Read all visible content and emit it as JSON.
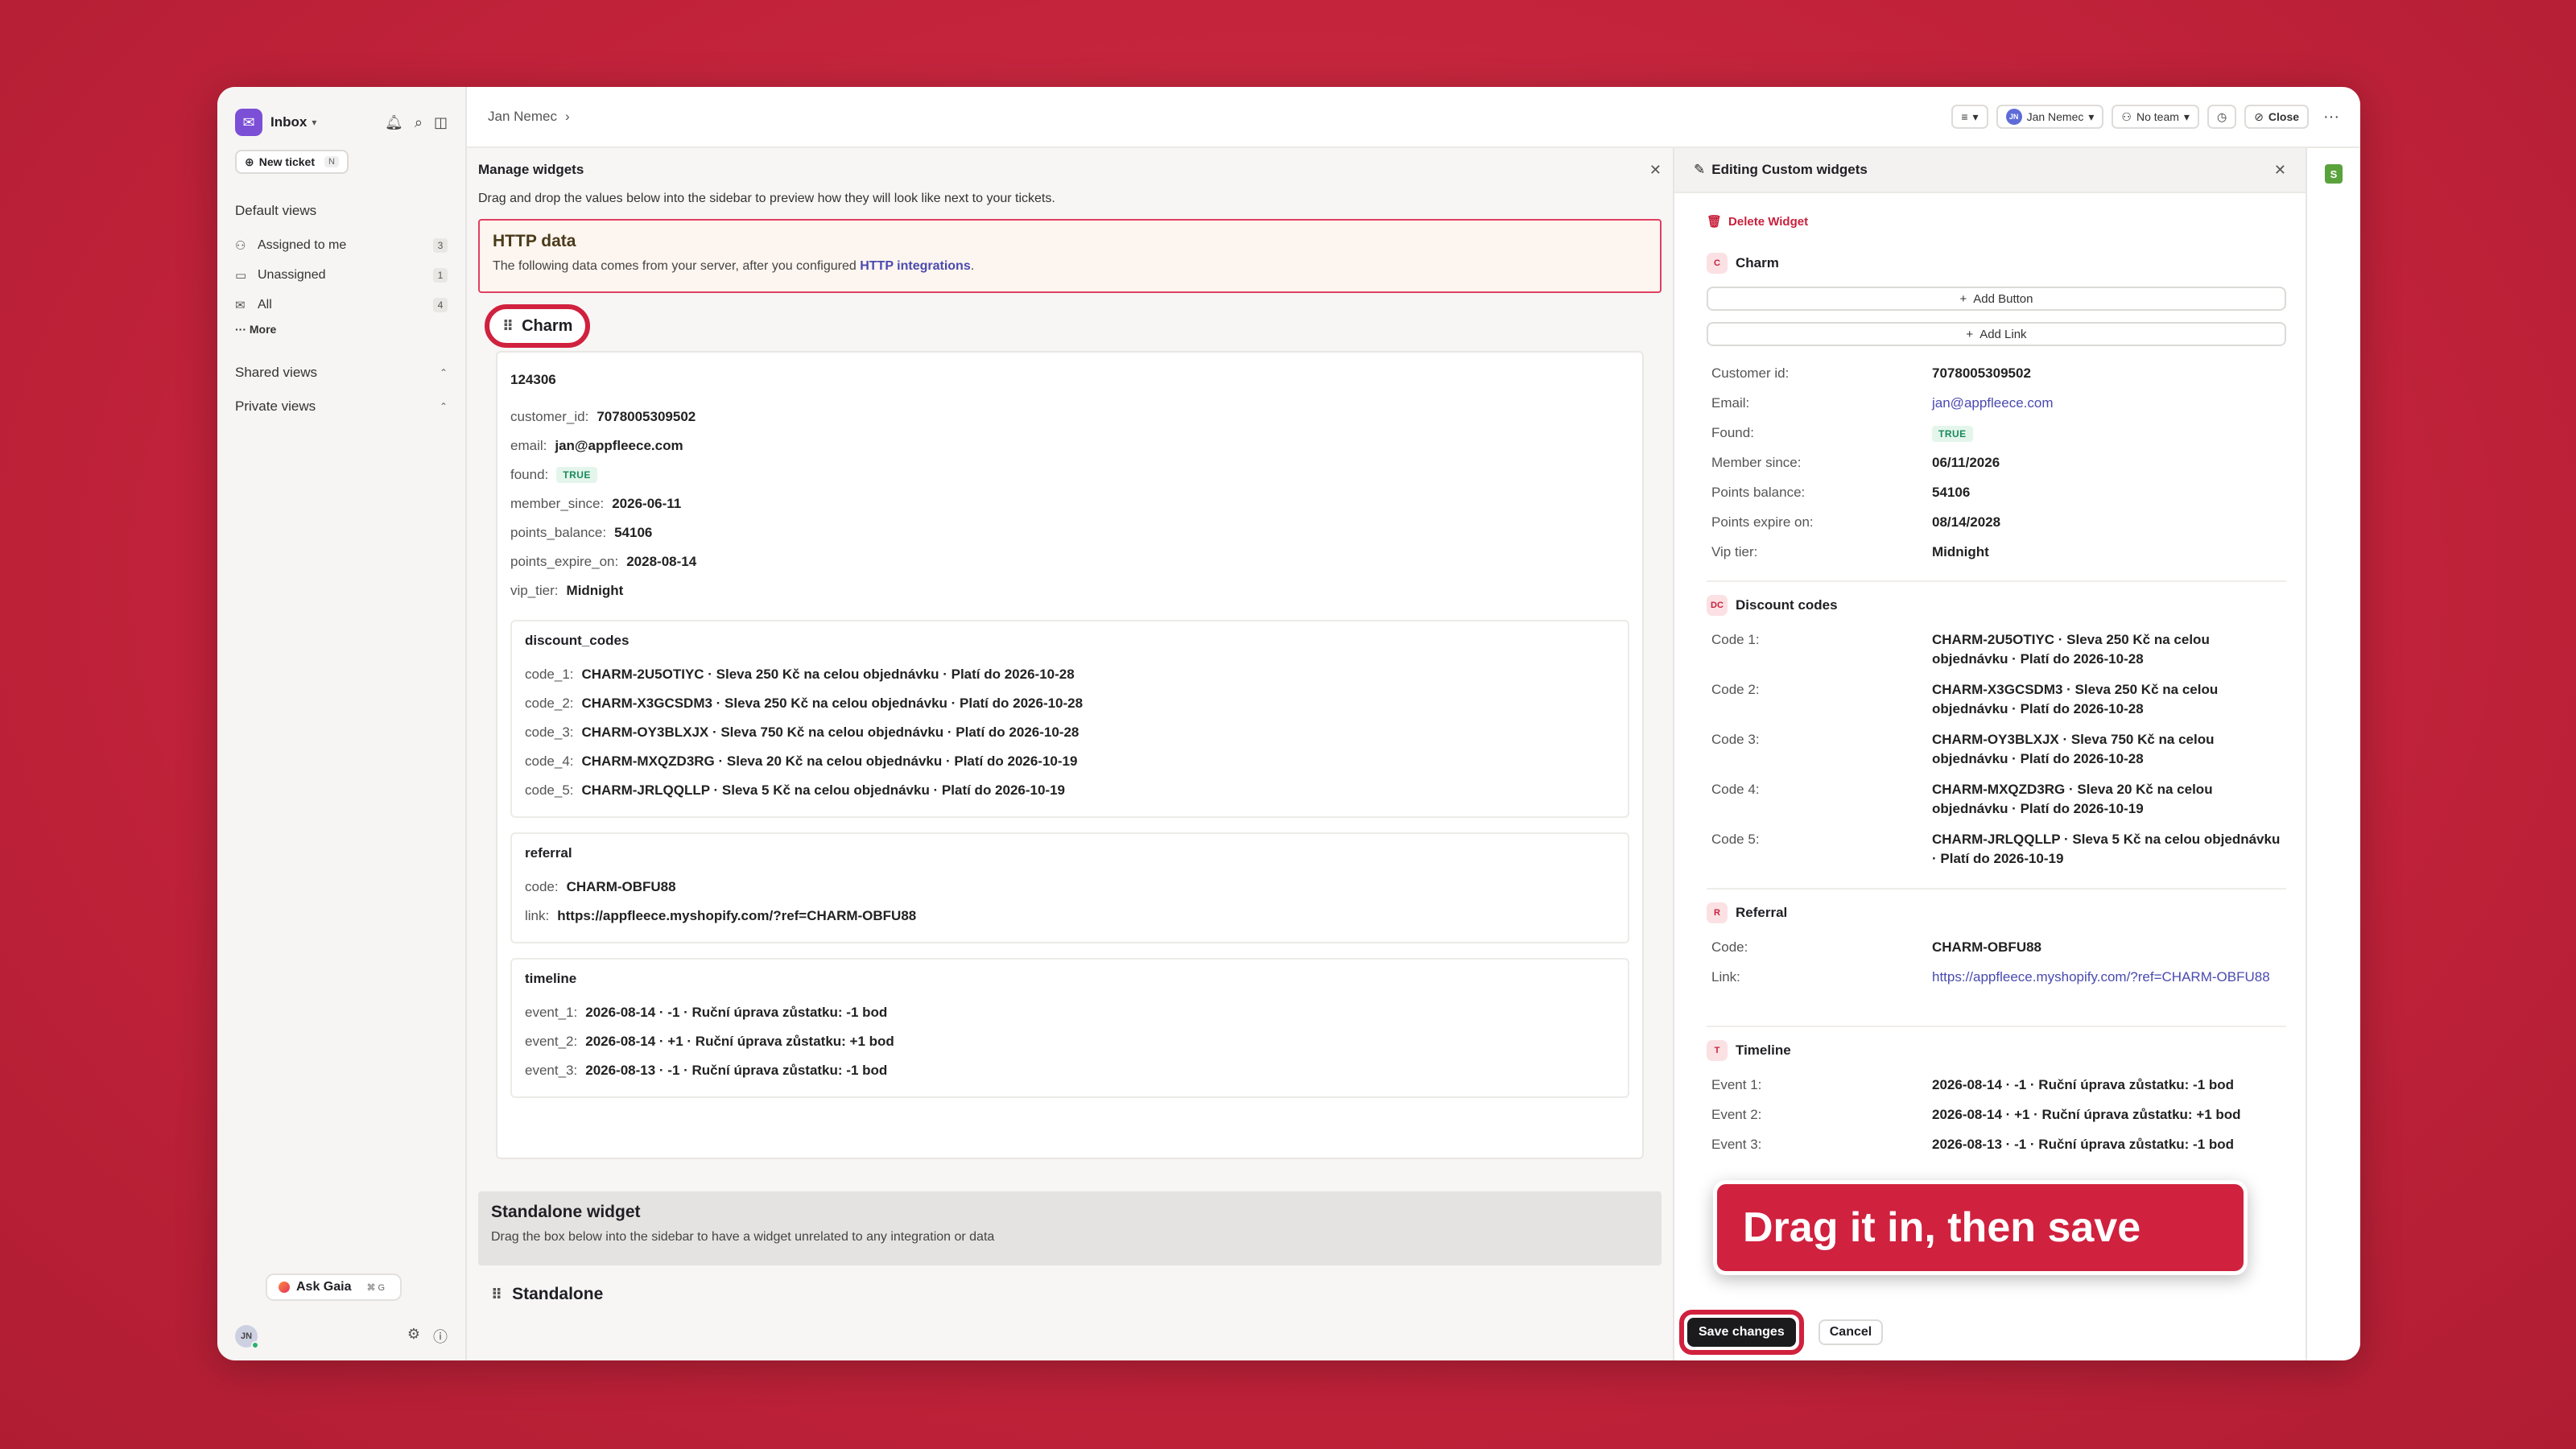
{
  "sidebar": {
    "inbox_label": "Inbox",
    "new_ticket_label": "New ticket",
    "new_ticket_shortcut": "N",
    "default_views_title": "Default views",
    "items": [
      {
        "label": "Assigned to me",
        "count": "3"
      },
      {
        "label": "Unassigned",
        "count": "1"
      },
      {
        "label": "All",
        "count": "4"
      }
    ],
    "more_label": "More",
    "shared_views_title": "Shared views",
    "private_views_title": "Private views",
    "ask_gaia_label": "Ask Gaia",
    "ask_gaia_shortcut": "⌘ G",
    "avatar_initials": "JN"
  },
  "topbar": {
    "breadcrumb": "Jan Nemec",
    "assignee_initials": "JN",
    "assignee": "Jan Nemec",
    "team": "No team",
    "close_label": "Close"
  },
  "manage": {
    "title": "Manage widgets",
    "description": "Drag and drop the values below into the sidebar to preview how they will look like next to your tickets.",
    "http_title": "HTTP data",
    "http_desc_prefix": "The following data comes from your server, after you configured ",
    "http_desc_link": "HTTP integrations",
    "http_desc_suffix": ".",
    "charm_label": "Charm",
    "charm_id": "124306",
    "fields": [
      {
        "k": "customer_id:",
        "v": "7078005309502"
      },
      {
        "k": "email:",
        "v": "jan@appfleece.com"
      },
      {
        "k": "found:",
        "v": "TRUE",
        "badge": true
      },
      {
        "k": "member_since:",
        "v": "2026-06-11"
      },
      {
        "k": "points_balance:",
        "v": "54106"
      },
      {
        "k": "points_expire_on:",
        "v": "2028-08-14"
      },
      {
        "k": "vip_tier:",
        "v": "Midnight"
      }
    ],
    "discount_title": "discount_codes",
    "discount_codes": [
      {
        "k": "code_1:",
        "v": "CHARM-2U5OTIYC · Sleva 250 Kč na celou objednávku · Platí do 2026-10-28"
      },
      {
        "k": "code_2:",
        "v": "CHARM-X3GCSDM3 · Sleva 250 Kč na celou objednávku · Platí do 2026-10-28"
      },
      {
        "k": "code_3:",
        "v": "CHARM-OY3BLXJX · Sleva 750 Kč na celou objednávku · Platí do 2026-10-28"
      },
      {
        "k": "code_4:",
        "v": "CHARM-MXQZD3RG · Sleva 20 Kč na celou objednávku · Platí do 2026-10-19"
      },
      {
        "k": "code_5:",
        "v": "CHARM-JRLQQLLP · Sleva 5 Kč na celou objednávku · Platí do 2026-10-19"
      }
    ],
    "referral_title": "referral",
    "referral": [
      {
        "k": "code:",
        "v": "CHARM-OBFU88"
      },
      {
        "k": "link:",
        "v": "https://appfleece.myshopify.com/?ref=CHARM-OBFU88"
      }
    ],
    "timeline_title": "timeline",
    "timeline": [
      {
        "k": "event_1:",
        "v": "2026-08-14 · -1 · Ruční úprava zůstatku: -1 bod"
      },
      {
        "k": "event_2:",
        "v": "2026-08-14 · +1 · Ruční úprava zůstatku: +1 bod"
      },
      {
        "k": "event_3:",
        "v": "2026-08-13 · -1 · Ruční úprava zůstatku: -1 bod"
      }
    ],
    "standalone_title": "Standalone widget",
    "standalone_desc": "Drag the box below into the sidebar to have a widget unrelated to any integration or data",
    "standalone_label": "Standalone"
  },
  "editing": {
    "title": "Editing Custom widgets",
    "delete_label": "Delete Widget",
    "charm_icon": "C",
    "charm_title": "Charm",
    "add_button_label": "Add Button",
    "add_link_label": "Add Link",
    "fields": [
      {
        "k": "Customer id:",
        "v": "7078005309502"
      },
      {
        "k": "Email:",
        "v": "jan@appfleece.com",
        "link": true
      },
      {
        "k": "Found:",
        "v": "TRUE",
        "badge": true
      },
      {
        "k": "Member since:",
        "v": "06/11/2026"
      },
      {
        "k": "Points balance:",
        "v": "54106"
      },
      {
        "k": "Points expire on:",
        "v": "08/14/2028"
      },
      {
        "k": "Vip tier:",
        "v": "Midnight"
      }
    ],
    "discount_icon": "DC",
    "discount_title": "Discount codes",
    "discount_codes": [
      {
        "k": "Code 1:",
        "v": "CHARM-2U5OTIYC · Sleva 250 Kč na celou objednávku · Platí do 2026-10-28"
      },
      {
        "k": "Code 2:",
        "v": "CHARM-X3GCSDM3 · Sleva 250 Kč na celou objednávku · Platí do 2026-10-28"
      },
      {
        "k": "Code 3:",
        "v": "CHARM-OY3BLXJX · Sleva 750 Kč na celou objednávku · Platí do 2026-10-28"
      },
      {
        "k": "Code 4:",
        "v": "CHARM-MXQZD3RG · Sleva 20 Kč na celou objednávku · Platí do 2026-10-19"
      },
      {
        "k": "Code 5:",
        "v": "CHARM-JRLQQLLP · Sleva 5 Kč na celou objednávku · Platí do 2026-10-19"
      }
    ],
    "referral_icon": "R",
    "referral_title": "Referral",
    "referral": [
      {
        "k": "Code:",
        "v": "CHARM-OBFU88"
      },
      {
        "k": "Link:",
        "v": "https://appfleece.myshopify.com/?ref=CHARM-OBFU88",
        "link": true
      }
    ],
    "timeline_icon": "T",
    "timeline_title": "Timeline",
    "timeline": [
      {
        "k": "Event 1:",
        "v": "2026-08-14 · -1 · Ruční úprava zůstatku: -1 bod"
      },
      {
        "k": "Event 2:",
        "v": "2026-08-14 · +1 · Ruční úprava zůstatku: +1 bod"
      },
      {
        "k": "Event 3:",
        "v": "2026-08-13 · -1 · Ruční úprava zůstatku: -1 bod"
      }
    ],
    "save_label": "Save changes",
    "cancel_label": "Cancel"
  },
  "annotation": {
    "banner_text": "Drag it in, then save"
  },
  "rail": {
    "shop_icon": "S"
  },
  "colors": {
    "accent_red": "#d0213e",
    "brand_purple": "#7b4fd6",
    "link": "#4a4ab0"
  }
}
